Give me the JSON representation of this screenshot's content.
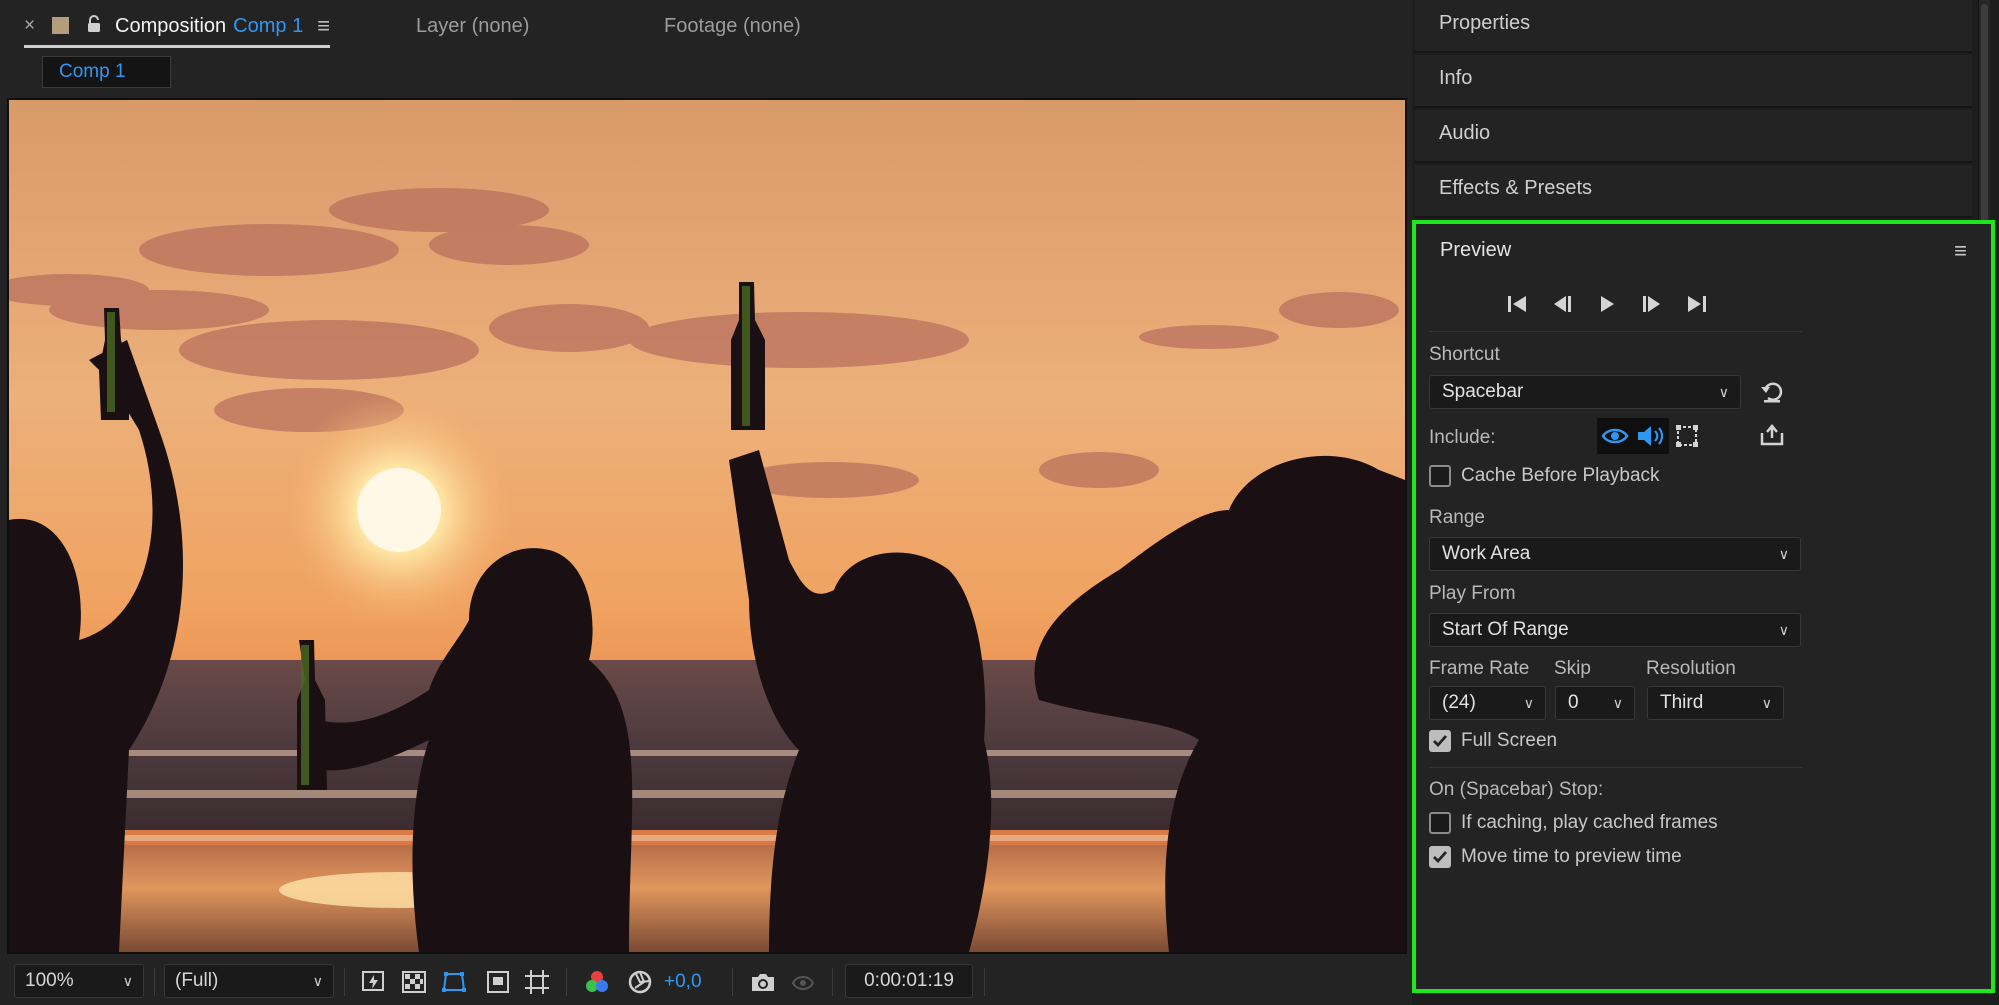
{
  "composition_panel": {
    "tabs": {
      "composition_label": "Composition",
      "composition_name": "Comp 1",
      "layer": "Layer (none)",
      "footage": "Footage (none)"
    },
    "chip": "Comp 1",
    "toolbar": {
      "zoom": "100%",
      "resolution": "(Full)",
      "exposure": "+0,0",
      "timecode": "0:00:01:19"
    }
  },
  "right_panels": {
    "properties": "Properties",
    "info": "Info",
    "audio": "Audio",
    "effects_presets": "Effects & Presets"
  },
  "preview": {
    "title": "Preview",
    "shortcut_label": "Shortcut",
    "shortcut_value": "Spacebar",
    "include_label": "Include:",
    "cache_before_playback": "Cache Before Playback",
    "cache_before_playback_checked": false,
    "range_label": "Range",
    "range_value": "Work Area",
    "play_from_label": "Play From",
    "play_from_value": "Start Of Range",
    "frame_rate_label": "Frame Rate",
    "frame_rate_value": "(24)",
    "skip_label": "Skip",
    "skip_value": "0",
    "resolution_label": "Resolution",
    "resolution_value": "Third",
    "full_screen": "Full Screen",
    "full_screen_checked": true,
    "on_stop_label": "On (Spacebar) Stop:",
    "if_caching": "If caching, play cached frames",
    "if_caching_checked": false,
    "move_time": "Move time to preview time",
    "move_time_checked": true
  },
  "colors": {
    "accent_blue": "#2e97f2",
    "highlight_green": "#1ee61e",
    "panel_bg": "#232323"
  }
}
